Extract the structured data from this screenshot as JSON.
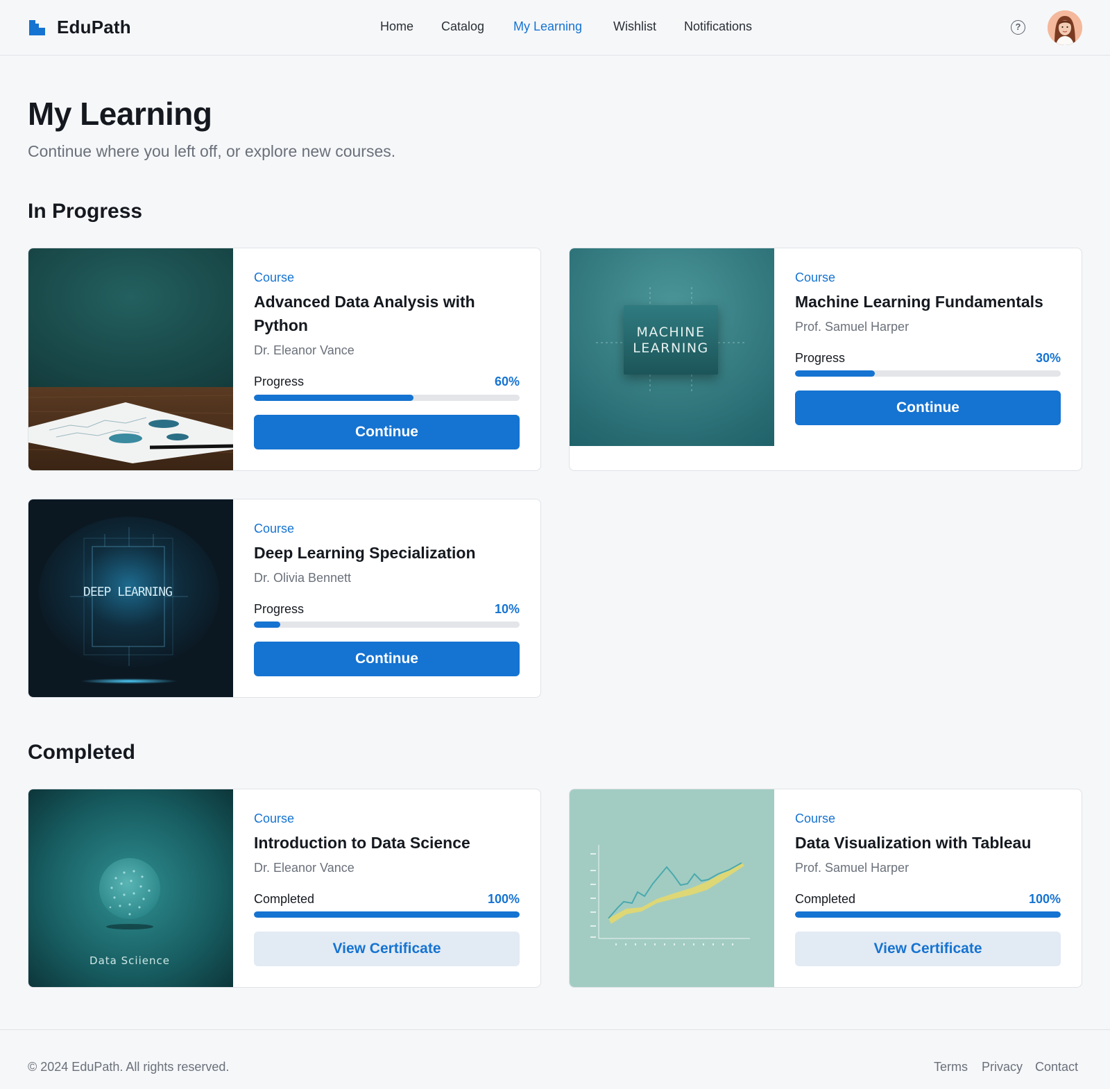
{
  "brand": {
    "name": "EduPath"
  },
  "nav": {
    "items": [
      {
        "label": "Home",
        "active": false
      },
      {
        "label": "Catalog",
        "active": false
      },
      {
        "label": "My Learning",
        "active": true
      },
      {
        "label": "Wishlist",
        "active": false
      },
      {
        "label": "Notifications",
        "active": false
      }
    ],
    "help_icon": "question-circle-icon",
    "help_glyph": "?"
  },
  "page": {
    "title": "My Learning",
    "subtitle": "Continue where you left off, or explore new courses."
  },
  "in_progress": {
    "heading": "In Progress",
    "courses": [
      {
        "kind": "Course",
        "title": "Advanced Data Analysis with Python",
        "instructor": "Dr. Eleanor Vance",
        "progress_label": "Progress",
        "progress_text": "60%",
        "progress": 0.6,
        "button": "Continue"
      },
      {
        "kind": "Course",
        "title": "Machine Learning Fundamentals",
        "instructor": "Prof. Samuel Harper",
        "progress_label": "Progress",
        "progress_text": "30%",
        "progress": 0.3,
        "button": "Continue",
        "thumb_text": [
          "MACHINE",
          "LEARNING"
        ]
      },
      {
        "kind": "Course",
        "title": "Deep Learning Specialization",
        "instructor": "Dr. Olivia Bennett",
        "progress_label": "Progress",
        "progress_text": "10%",
        "progress": 0.1,
        "button": "Continue",
        "thumb_text": "DEEP LEARNING"
      }
    ]
  },
  "completed": {
    "heading": "Completed",
    "courses": [
      {
        "kind": "Course",
        "title": "Introduction to Data Science",
        "instructor": "Dr. Eleanor Vance",
        "progress_label": "Completed",
        "progress_text": "100%",
        "progress": 1.0,
        "button": "View Certificate",
        "thumb_text": "Data Sciience"
      },
      {
        "kind": "Course",
        "title": "Data Visualization with Tableau",
        "instructor": "Prof. Samuel Harper",
        "progress_label": "Completed",
        "progress_text": "100%",
        "progress": 1.0,
        "button": "View Certificate"
      }
    ]
  },
  "footer": {
    "copyright": "© 2024 EduPath. All rights reserved.",
    "links": [
      "Terms",
      "Privacy",
      "Contact"
    ]
  },
  "colors": {
    "accent": "#1573d1",
    "background": "#f6f7f9",
    "card": "#ffffff",
    "border": "#dfe2e6",
    "muted_text": "#6a707a",
    "secondary_button": "#e2eaf3"
  }
}
